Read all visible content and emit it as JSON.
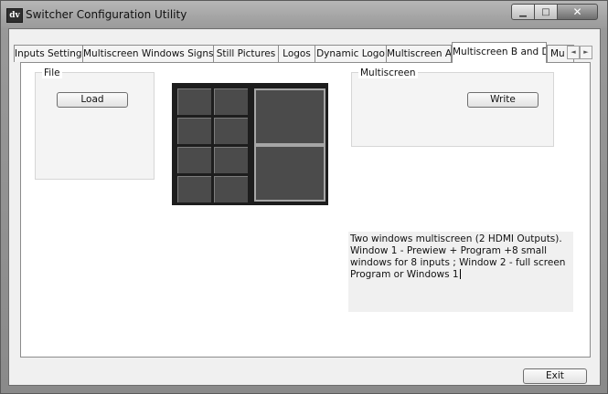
{
  "window": {
    "app_icon_text": "dv",
    "title": "Switcher Configuration Utility",
    "minimize_glyph": "▁",
    "maximize_glyph": "□",
    "close_glyph": "✕"
  },
  "tabs": [
    {
      "label": "Inputs Settings"
    },
    {
      "label": "Multiscreen Windows Signs"
    },
    {
      "label": "Still Pictures"
    },
    {
      "label": "Logos"
    },
    {
      "label": "Dynamic Logo"
    },
    {
      "label": "Multiscreen A"
    },
    {
      "label": "Multiscreen B and D",
      "active": true
    },
    {
      "label": "Mu"
    }
  ],
  "tab_scroll": {
    "left": "◄",
    "right": "►"
  },
  "file_group": {
    "legend": "File",
    "load_label": "Load"
  },
  "multiscreen_group": {
    "legend": "Multiscreen",
    "write_label": "Write"
  },
  "description": "Two windows multiscreen  (2 HDMI Outputs).  Window 1 - Prewiew + Program +8 small windows for 8 inputs ; Window 2 - full screen Program  or  Windows 1",
  "footer": {
    "exit_label": "Exit"
  },
  "layout_preview": {
    "small_windows": 8,
    "large_windows": 2
  }
}
